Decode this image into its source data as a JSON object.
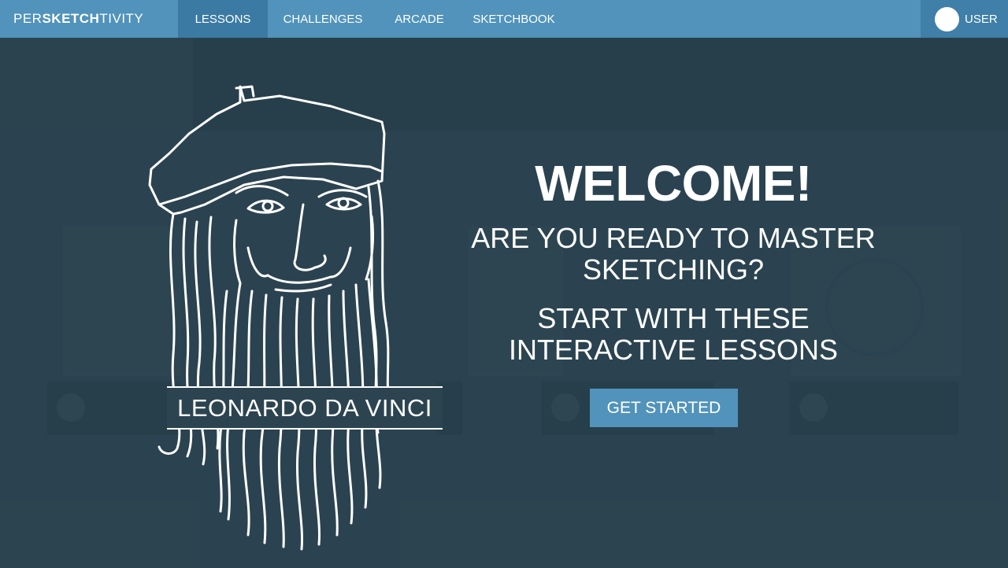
{
  "nav": {
    "logo_prefix": "PER",
    "logo_bold": "SKETCH",
    "logo_suffix": "TIVITY",
    "items": [
      {
        "label": "LESSONS",
        "active": true
      },
      {
        "label": "CHALLENGES",
        "active": false
      },
      {
        "label": "ARCADE",
        "active": false
      },
      {
        "label": "SKETCHBOOK",
        "active": false
      }
    ],
    "user_label": "USER"
  },
  "portrait": {
    "caption": "LEONARDO DA VINCI"
  },
  "welcome": {
    "title": "WELCOME!",
    "line1a": "ARE YOU READY TO MASTER",
    "line1b": "SKETCHING?",
    "line2a": "START WITH THESE",
    "line2b": "INTERACTIVE LESSONS",
    "button": "GET STARTED"
  },
  "colors": {
    "nav_bg": "#5193bb",
    "nav_active": "#3b7aa3",
    "overlay_bg": "#2c4450",
    "accent_button": "#5193bb"
  }
}
